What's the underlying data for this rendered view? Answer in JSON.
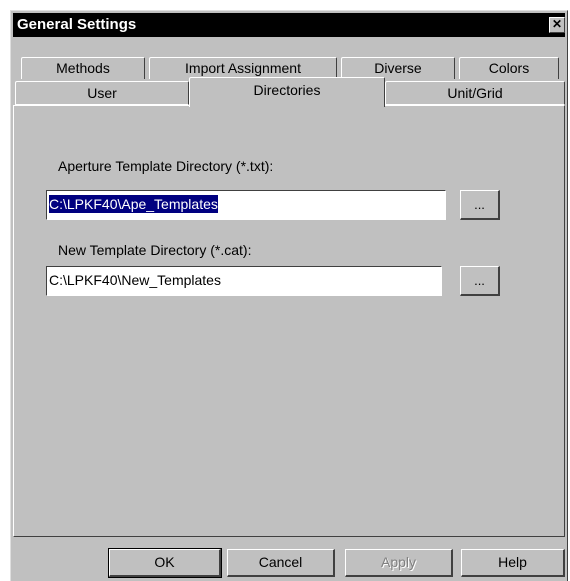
{
  "window": {
    "title": "General Settings",
    "close_glyph": "✕"
  },
  "tabs": {
    "back_row": [
      "Methods",
      "Import Assignment",
      "Diverse",
      "Colors"
    ],
    "front_row": [
      "User",
      "Directories",
      "Unit/Grid"
    ],
    "active": "Directories"
  },
  "directories": {
    "aperture_label": "Aperture Template Directory (*.txt):",
    "aperture_value": "C:\\LPKF40\\Ape_Templates",
    "new_label": "New Template Directory (*.cat):",
    "new_value": "C:\\LPKF40\\New_Templates",
    "browse_label": "..."
  },
  "buttons": {
    "ok": "OK",
    "cancel": "Cancel",
    "apply": "Apply",
    "help": "Help"
  }
}
